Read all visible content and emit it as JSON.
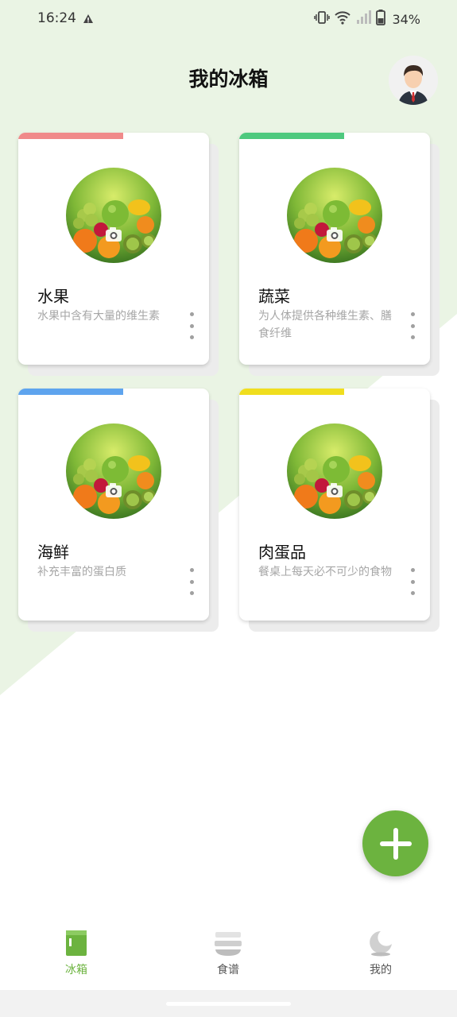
{
  "status_bar": {
    "time": "16:24",
    "battery": "34%"
  },
  "header": {
    "title": "我的冰箱"
  },
  "colors": {
    "brand_green": "#6cb33f",
    "background_tint": "#eaf4e4"
  },
  "cards": [
    {
      "title": "水果",
      "desc": "水果中含有大量的维生素",
      "accent": "#f08a8a"
    },
    {
      "title": "蔬菜",
      "desc": "为人体提供各种维生素、膳食纤维",
      "accent": "#4ec97e"
    },
    {
      "title": "海鲜",
      "desc": "补充丰富的蛋白质",
      "accent": "#5ea4ee"
    },
    {
      "title": "肉蛋品",
      "desc": "餐桌上每天必不可少的食物",
      "accent": "#f0de1e"
    }
  ],
  "fab": {
    "icon": "plus-icon"
  },
  "bottom_nav": {
    "items": [
      {
        "label": "冰箱",
        "icon": "fridge-icon",
        "active": true
      },
      {
        "label": "食谱",
        "icon": "recipe-bowl-icon",
        "active": false
      },
      {
        "label": "我的",
        "icon": "moon-profile-icon",
        "active": false
      }
    ]
  }
}
